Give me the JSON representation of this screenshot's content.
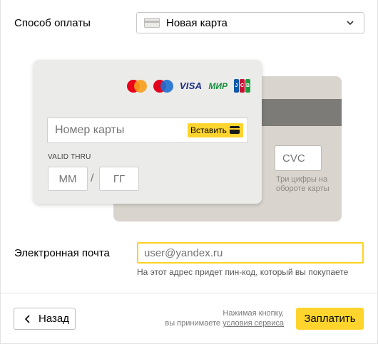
{
  "payment": {
    "label": "Способ оплаты",
    "selected": "Новая карта"
  },
  "card": {
    "number_placeholder": "Номер карты",
    "paste_label": "Вставить",
    "valid_thru": "VALID THRU",
    "month_placeholder": "ММ",
    "year_placeholder": "ГГ",
    "separator": "/",
    "cvc_placeholder": "CVC",
    "cvc_hint": "Три цифры на обороте карты",
    "brands": {
      "visa": "VISA",
      "mir": "МИР",
      "jcb": [
        "J",
        "C",
        "B"
      ]
    },
    "icons": [
      "card-icon",
      "mastercard-logo",
      "maestro-logo",
      "visa-logo",
      "mir-logo",
      "jcb-logo",
      "card-paste-icon"
    ]
  },
  "email": {
    "label": "Электронная почта",
    "placeholder": "user@yandex.ru",
    "hint": "На этот адрес придет пин-код, который вы покупаете"
  },
  "footer": {
    "back_label": "Назад",
    "terms_line1": "Нажимая кнопку,",
    "terms_line2_prefix": "вы принимаете ",
    "terms_link": "условия сервиса",
    "pay_label": "Заплатить"
  },
  "colors": {
    "accent": "#ffd52d",
    "email_border": "#ffd21f",
    "card_front": "#ebebea",
    "card_back": "#d9d5ce",
    "stripe": "#7d7b77"
  }
}
